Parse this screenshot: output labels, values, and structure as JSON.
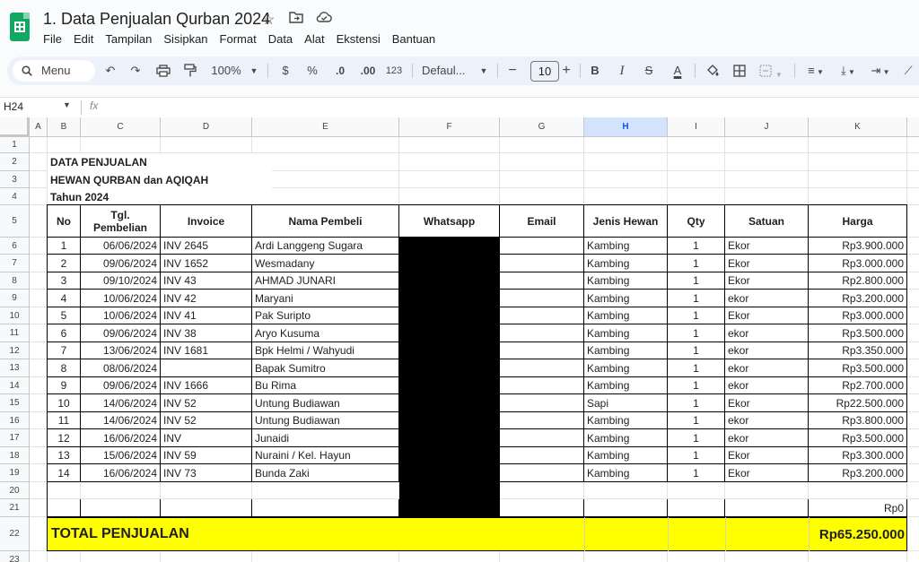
{
  "app": {
    "doc_title": "1. Data Penjualan Qurban 2024",
    "menus": [
      "File",
      "Edit",
      "Tampilan",
      "Sisipkan",
      "Format",
      "Data",
      "Alat",
      "Ekstensi",
      "Bantuan"
    ]
  },
  "toolbar": {
    "menu_search": "Menu",
    "zoom": "100%",
    "currency": "$",
    "percent": "%",
    "dec_less": ".0",
    "dec_more": ".00",
    "number_format": "123",
    "font": "Defaul...",
    "font_size": "10",
    "minus": "−",
    "plus": "+",
    "bold": "B",
    "italic": "I",
    "strike": "S",
    "text_color": "A"
  },
  "formula_bar": {
    "name_box": "H24",
    "fx": "fx"
  },
  "grid": {
    "columns": [
      "A",
      "B",
      "C",
      "D",
      "E",
      "F",
      "G",
      "H",
      "I",
      "J",
      "K"
    ],
    "rows": [
      "1",
      "2",
      "3",
      "4",
      "5",
      "6",
      "7",
      "8",
      "9",
      "10",
      "11",
      "12",
      "13",
      "14",
      "15",
      "16",
      "17",
      "18",
      "19",
      "20",
      "21",
      "22",
      "23"
    ],
    "selected_column": "H"
  },
  "sheet": {
    "title1": "DATA PENJUALAN",
    "title2": "HEWAN QURBAN dan AQIQAH",
    "title3": "Tahun 2024",
    "headers": [
      "No",
      "Tgl. Pembelian",
      "Invoice",
      "Nama Pembeli",
      "Whatsapp",
      "Email",
      "Jenis Hewan",
      "Qty",
      "Satuan",
      "Harga"
    ],
    "rows": [
      [
        "1",
        "06/06/2024",
        "INV 2645",
        "Ardi Langgeng Sugara",
        "",
        "",
        "Kambing",
        "1",
        "Ekor",
        "Rp3.900.000"
      ],
      [
        "2",
        "09/06/2024",
        "INV 1652",
        "Wesmadany",
        "",
        "",
        "Kambing",
        "1",
        "Ekor",
        "Rp3.000.000"
      ],
      [
        "3",
        "09/10/2024",
        "INV 43",
        "AHMAD JUNARI",
        "",
        "",
        "Kambing",
        "1",
        "Ekor",
        "Rp2.800.000"
      ],
      [
        "4",
        "10/06/2024",
        "INV 42",
        "Maryani",
        "",
        "",
        "Kambing",
        "1",
        "ekor",
        "Rp3.200.000"
      ],
      [
        "5",
        "10/06/2024",
        "INV 41",
        "Pak Suripto",
        "",
        "",
        "Kambing",
        "1",
        "Ekor",
        "Rp3.000.000"
      ],
      [
        "6",
        "09/06/2024",
        "INV 38",
        "Aryo Kusuma",
        "",
        "",
        "Kambing",
        "1",
        "ekor",
        "Rp3.500.000"
      ],
      [
        "7",
        "13/06/2024",
        "INV 1681",
        "Bpk Helmi / Wahyudi",
        "",
        "",
        "Kambing",
        "1",
        "ekor",
        "Rp3.350.000"
      ],
      [
        "8",
        "08/06/2024",
        "",
        "Bapak Sumitro",
        "",
        "",
        "Kambing",
        "1",
        "ekor",
        "Rp3.500.000"
      ],
      [
        "9",
        "09/06/2024",
        "INV 1666",
        "Bu Rima",
        "",
        "",
        "Kambing",
        "1",
        "ekor",
        "Rp2.700.000"
      ],
      [
        "10",
        "14/06/2024",
        "INV 52",
        "Untung Budiawan",
        "",
        "",
        "Sapi",
        "1",
        "Ekor",
        "Rp22.500.000"
      ],
      [
        "11",
        "14/06/2024",
        "INV 52",
        "Untung Budiawan",
        "",
        "",
        "Kambing",
        "1",
        "ekor",
        "Rp3.800.000"
      ],
      [
        "12",
        "16/06/2024",
        "INV",
        "Junaidi",
        "",
        "",
        "Kambing",
        "1",
        "ekor",
        "Rp3.500.000"
      ],
      [
        "13",
        "15/06/2024",
        "INV 59",
        "Nuraini / Kel. Hayun",
        "",
        "",
        "Kambing",
        "1",
        "Ekor",
        "Rp3.300.000"
      ],
      [
        "14",
        "16/06/2024",
        "INV 73",
        "Bunda Zaki",
        "",
        "",
        "Kambing",
        "1",
        "Ekor",
        "Rp3.200.000"
      ]
    ],
    "empty_row_harga": "Rp0",
    "total_label": "TOTAL PENJUALAN",
    "total_value": "Rp65.250.000"
  },
  "colors": {
    "total_fill": "#ffff00",
    "accent": "#0b57d0",
    "logo": "#11a861"
  }
}
